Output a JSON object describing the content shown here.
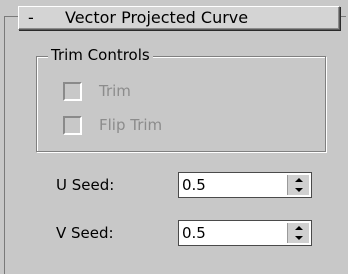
{
  "rollout": {
    "collapse_sign": "-",
    "title": "Vector Projected Curve"
  },
  "trim_controls": {
    "label": "Trim Controls",
    "trim_label": "Trim",
    "trim_checked": false,
    "trim_enabled": false,
    "flip_trim_label": "Flip Trim",
    "flip_trim_checked": false,
    "flip_trim_enabled": false
  },
  "u_seed": {
    "label": "U Seed:",
    "value": "0.5"
  },
  "v_seed": {
    "label": "V Seed:",
    "value": "0.5"
  },
  "icons": {
    "spinner_up": "triangle-up-icon",
    "spinner_down": "triangle-down-icon"
  }
}
